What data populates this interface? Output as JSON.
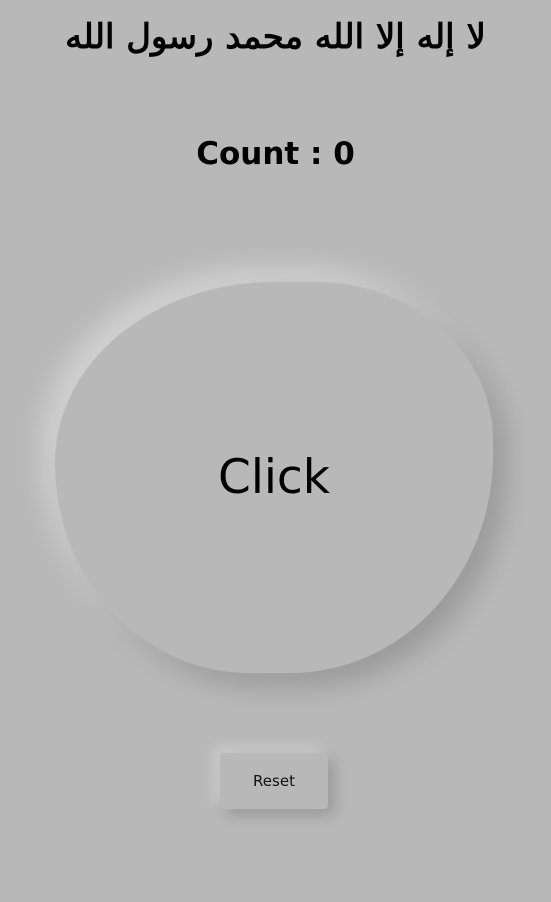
{
  "kalima": "لا إله إلا الله محمد رسول الله",
  "counter": {
    "label": "Count",
    "separator": " : ",
    "value": "0"
  },
  "buttons": {
    "click_label": "Click",
    "reset_label": "Reset"
  },
  "colors": {
    "background": "#b8b8b8",
    "text": "#000000"
  }
}
